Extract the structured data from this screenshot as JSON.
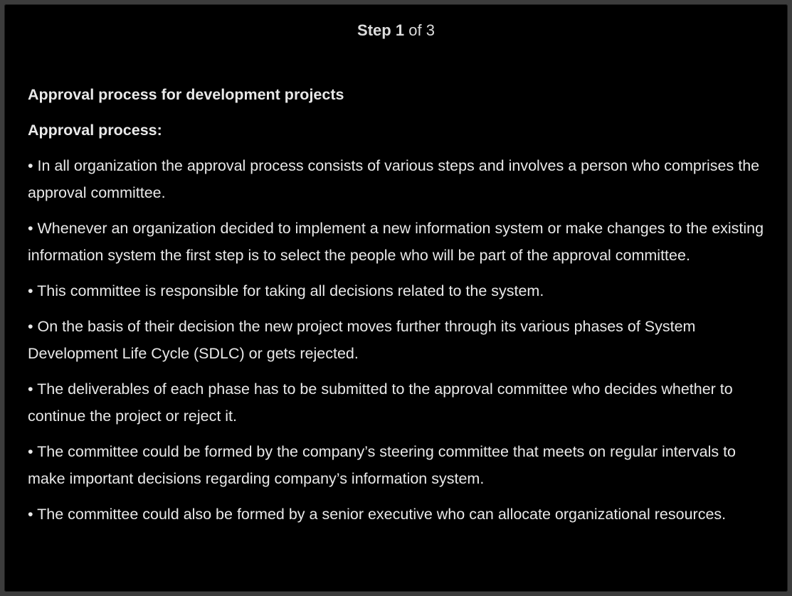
{
  "header": {
    "step_word": "Step",
    "step_current": "1",
    "step_of": "of 3"
  },
  "content": {
    "title": "Approval process for development projects",
    "subtitle": "Approval process:",
    "bullets": [
      "• In all organization the approval process consists of various steps and involves a person who comprises the approval committee.",
      "• Whenever an organization decided to implement a new information system or make changes to the existing information system the first step is to select the people who will be part of the approval committee.",
      "• This committee is responsible for taking all decisions related to the system.",
      "• On the basis of their decision the new project moves further through its various phases of System Development Life Cycle (SDLC) or gets rejected.",
      "• The deliverables of each phase has to be submitted to the approval committee who decides whether to continue the project or reject it.",
      "• The committee could be formed by the company’s steering committee that meets on regular intervals to make important decisions regarding company’s information system.",
      "• The committee could also be formed by a senior executive who can allocate organizational resources."
    ]
  }
}
